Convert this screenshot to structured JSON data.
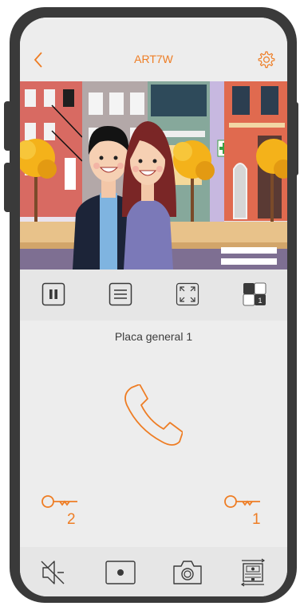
{
  "header": {
    "title": "ART7W",
    "back_icon": "chevron-left-icon",
    "settings_icon": "gear-icon"
  },
  "video": {
    "description_icon": "camera-feed"
  },
  "toolbar": {
    "pause_icon": "pause-icon",
    "menu_icon": "menu-icon",
    "fullscreen_icon": "fullscreen-icon",
    "camera_select_icon": "camera-quad-icon",
    "camera_badge": "1"
  },
  "panel": {
    "station_label": "Placa general 1"
  },
  "locks": [
    {
      "number": "2"
    },
    {
      "number": "1"
    }
  ],
  "bottom_bar": {
    "mute_icon": "speaker-muted-icon",
    "record_icon": "record-icon",
    "snapshot_icon": "camera-icon",
    "gallery_icon": "gallery-icon"
  },
  "colors": {
    "accent": "#ee7d24",
    "frame": "#3a3a3a",
    "screen_bg": "#ededed"
  }
}
